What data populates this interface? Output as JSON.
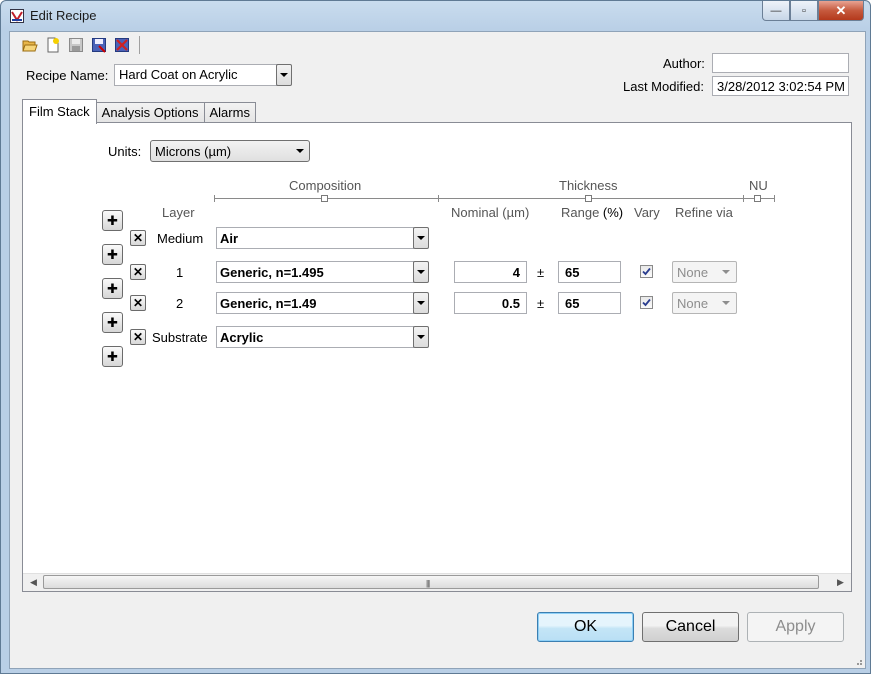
{
  "window": {
    "title": "Edit Recipe"
  },
  "caption": {
    "minimize": "—",
    "maximize": "▫",
    "close": "✕"
  },
  "toolbar": {
    "icons": [
      "open-folder-icon",
      "new-recipe-icon",
      "save-icon",
      "save-as-icon",
      "delete-recipe-icon"
    ]
  },
  "header": {
    "recipe_name_label": "Recipe Name:",
    "recipe_name_value": "Hard Coat on Acrylic",
    "author_label": "Author:",
    "author_value": "",
    "last_modified_label": "Last Modified:",
    "last_modified_value": "3/28/2012 3:02:54 PM"
  },
  "tabs": [
    {
      "label": "Film Stack",
      "active": true
    },
    {
      "label": "Analysis Options",
      "active": false
    },
    {
      "label": "Alarms",
      "active": false
    }
  ],
  "film_stack": {
    "units_label": "Units:",
    "units_value": "Microns (µm)",
    "group_headers": {
      "composition": "Composition",
      "thickness": "Thickness",
      "nu": "NU"
    },
    "col_headers": {
      "layer": "Layer",
      "nominal": "Nominal (µm)",
      "range_prefix": "Range ",
      "range_suffix": "(%)",
      "vary": "Vary",
      "refine_via": "Refine via"
    },
    "insert_symbol": "✚",
    "delete_symbol": "✕",
    "plus_minus": "±",
    "layers": [
      {
        "name": "Medium",
        "material": "Air"
      },
      {
        "name": "1",
        "material": "Generic, n=1.495",
        "nominal": "4",
        "range": "65",
        "vary": true,
        "refine_via": "None"
      },
      {
        "name": "2",
        "material": "Generic, n=1.49",
        "nominal": "0.5",
        "range": "65",
        "vary": true,
        "refine_via": "None"
      },
      {
        "name": "Substrate",
        "material": "Acrylic"
      }
    ],
    "scroll_grip": "|||"
  },
  "buttons": {
    "ok": "OK",
    "cancel": "Cancel",
    "apply": "Apply"
  }
}
